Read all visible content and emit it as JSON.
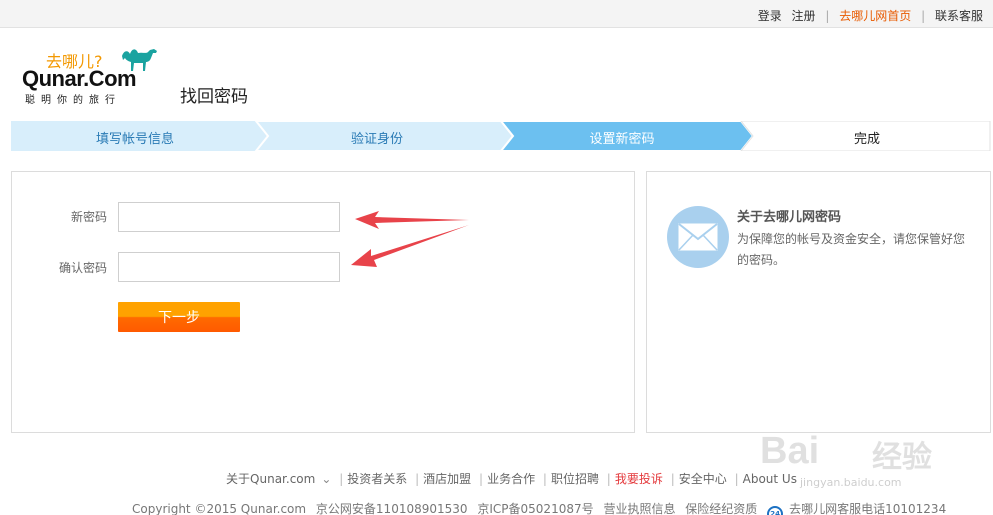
{
  "topnav": {
    "login": "登录",
    "register": "注册",
    "home": "去哪儿网首页",
    "support": "联系客服",
    "separator": "|"
  },
  "logo": {
    "cn": "去哪儿?",
    "en": "Qunar.Com",
    "slogan": "聪明你的旅行"
  },
  "page": {
    "title": "找回密码"
  },
  "steps": [
    {
      "label": "填写帐号信息",
      "state": "done"
    },
    {
      "label": "验证身份",
      "state": "done"
    },
    {
      "label": "设置新密码",
      "state": "active"
    },
    {
      "label": "完成",
      "state": "todo"
    }
  ],
  "form": {
    "new_password_label": "新密码",
    "confirm_password_label": "确认密码",
    "new_password_value": "",
    "confirm_password_value": "",
    "next_label": "下一步"
  },
  "info": {
    "icon": "mail-icon",
    "title": "关于去哪儿网密码",
    "text": "为保障您的帐号及资金安全，请您保管好您的密码。"
  },
  "footer": {
    "links": [
      "关于Qunar.com",
      "投资者关系",
      "酒店加盟",
      "业务合作",
      "职位招聘",
      "我要投诉",
      "安全中心",
      "About Us"
    ],
    "copyright": "Copyright ©2015 Qunar.com",
    "beian": "京公网安备110108901530",
    "icp": "京ICP备05021087号",
    "license": "营业执照信息",
    "insurance": "保险经纪资质",
    "badge": "24",
    "hotline": "去哪儿网客服电话10101234"
  },
  "watermark": {
    "text": "Bai",
    "cn": "经验",
    "url": "jingyan.baidu.com"
  },
  "colors": {
    "step_done": "#d8eefb",
    "step_active": "#6cc0f0",
    "step_done_text": "#2a7bb5",
    "accent_orange": "#ff8a00",
    "annotation_arrow": "#e8434a"
  }
}
